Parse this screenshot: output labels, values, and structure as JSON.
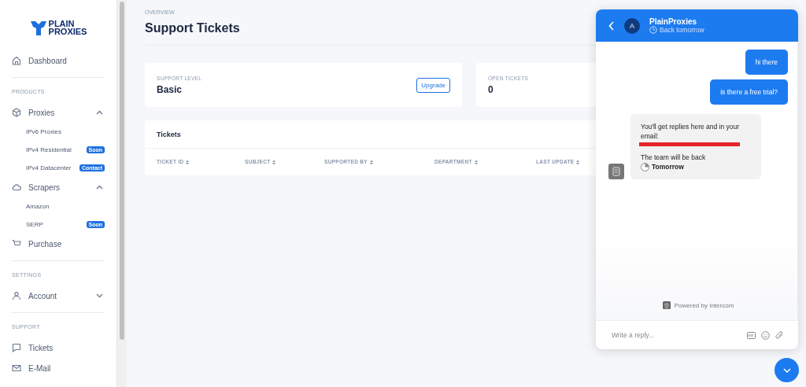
{
  "logo": {
    "line1": "PLAIN",
    "line2": "PROXIES"
  },
  "sidebar": {
    "items": [
      {
        "kind": "link",
        "label": "Dashboard"
      },
      {
        "kind": "divider"
      },
      {
        "kind": "section",
        "label": "PRODUCTS"
      },
      {
        "kind": "group",
        "label": "Proxies",
        "expanded": true,
        "children": [
          {
            "label": "IPv6 Proxies"
          },
          {
            "label": "IPv4 Residential",
            "badge": "Soon"
          },
          {
            "label": "IPv4 Datacenter",
            "badge": "Contact"
          }
        ]
      },
      {
        "kind": "group",
        "label": "Scrapers",
        "expanded": true,
        "children": [
          {
            "label": "Amazon"
          },
          {
            "label": "SERP",
            "badge": "Soon"
          }
        ]
      },
      {
        "kind": "link",
        "label": "Purchase"
      },
      {
        "kind": "divider"
      },
      {
        "kind": "section",
        "label": "SETTINGS"
      },
      {
        "kind": "group",
        "label": "Account",
        "expanded": false
      },
      {
        "kind": "divider"
      },
      {
        "kind": "section",
        "label": "SUPPORT"
      },
      {
        "kind": "link",
        "label": "Tickets"
      },
      {
        "kind": "link",
        "label": "E-Mail"
      }
    ]
  },
  "header": {
    "eyebrow": "OVERVIEW",
    "title": "Support Tickets"
  },
  "cards": [
    {
      "label": "SUPPORT LEVEL",
      "value": "Basic",
      "button": "Upgrade"
    },
    {
      "label": "OPEN TICKETS",
      "value": "0"
    }
  ],
  "table": {
    "title": "Tickets",
    "columns": [
      "TICKET ID",
      "SUBJECT",
      "SUPPORTED BY",
      "DEPARTMENT",
      "LAST UPDATE"
    ]
  },
  "chat": {
    "avatar": "A",
    "name": "PlainProxies",
    "status": "Back tomorrow",
    "messages": [
      {
        "kind": "user",
        "text": "hi there"
      },
      {
        "kind": "user",
        "text": "is there a free trial?"
      },
      {
        "kind": "bot",
        "line1": "You'll get replies here and in your email:",
        "line2": "The team will be back",
        "line3": "Tomorrow"
      }
    ],
    "powered": "Powered by Intercom",
    "placeholder": "Write a reply..."
  }
}
